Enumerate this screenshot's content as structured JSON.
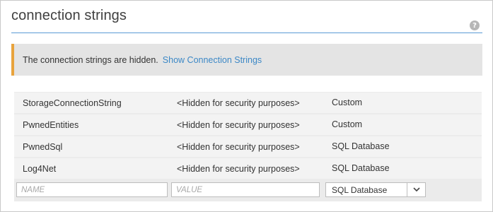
{
  "header": {
    "title": "connection strings",
    "help_icon": "question-circle-icon"
  },
  "notice": {
    "text": "The connection strings are hidden.",
    "link_label": "Show Connection Strings",
    "accent_color": "#e8a33d",
    "link_color": "#3c88c6"
  },
  "rows": [
    {
      "name": "StorageConnectionString",
      "value": "<Hidden for security purposes>",
      "type": "Custom"
    },
    {
      "name": "PwnedEntities",
      "value": "<Hidden for security purposes>",
      "type": "Custom"
    },
    {
      "name": "PwnedSql",
      "value": "<Hidden for security purposes>",
      "type": "SQL Database"
    },
    {
      "name": "Log4Net",
      "value": "<Hidden for security purposes>",
      "type": "SQL Database"
    }
  ],
  "new_entry": {
    "name_placeholder": "NAME",
    "value_placeholder": "VALUE",
    "type_selected": "SQL Database",
    "dropdown_icon": "chevron-down-icon"
  }
}
